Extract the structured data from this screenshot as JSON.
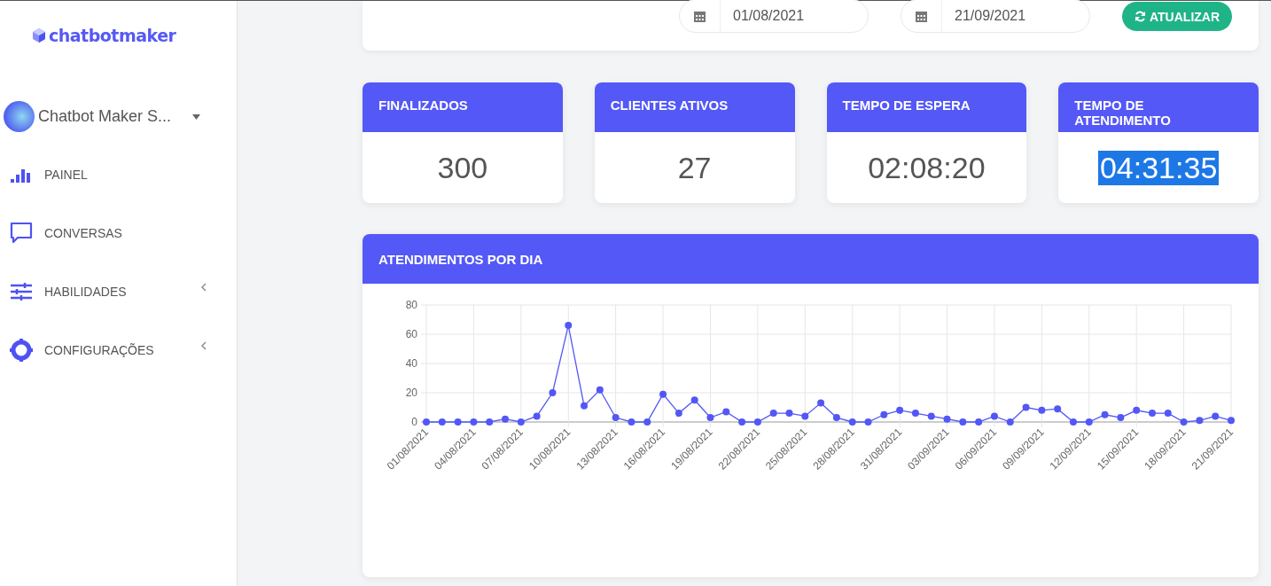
{
  "sidebar": {
    "logo": "chatbotmaker",
    "account": {
      "name": "Chatbot Maker S..."
    },
    "items": [
      {
        "label": "PAINEL",
        "kind": "bars",
        "expandable": false
      },
      {
        "label": "CONVERSAS",
        "kind": "chat",
        "expandable": false
      },
      {
        "label": "HABILIDADES",
        "kind": "sliders",
        "expandable": true
      },
      {
        "label": "CONFIGURAÇÕES",
        "kind": "gear",
        "expandable": true
      }
    ]
  },
  "filters": {
    "start_date": "01/08/2021",
    "end_date": "21/09/2021",
    "refresh_button": "ATUALIZAR"
  },
  "stats": [
    {
      "title": "FINALIZADOS",
      "value": "300",
      "highlighted": false
    },
    {
      "title": "CLIENTES ATIVOS",
      "value": "27",
      "highlighted": false
    },
    {
      "title": "TEMPO DE ESPERA",
      "value": "02:08:20",
      "highlighted": false
    },
    {
      "title": "TEMPO DE ATENDIMENTO",
      "value": "04:31:35",
      "highlighted": true
    }
  ],
  "chart_card": {
    "title": "ATENDIMENTOS POR DIA",
    "chart_data": {
      "type": "line",
      "categories": [
        "01/08/2021",
        null,
        null,
        "04/08/2021",
        null,
        null,
        "07/08/2021",
        null,
        null,
        "10/08/2021",
        null,
        null,
        "13/08/2021",
        null,
        null,
        "16/08/2021",
        null,
        null,
        "19/08/2021",
        null,
        null,
        "22/08/2021",
        null,
        null,
        "25/08/2021",
        null,
        null,
        "28/08/2021",
        null,
        null,
        "31/08/2021",
        null,
        null,
        "03/09/2021",
        null,
        null,
        "06/09/2021",
        null,
        null,
        "09/09/2021",
        null,
        null,
        "12/09/2021",
        null,
        null,
        "15/09/2021",
        null,
        null,
        "18/09/2021",
        null,
        null,
        "21/09/2021"
      ],
      "grid": true,
      "series": [
        {
          "color": "#5257f5",
          "marker": "circle",
          "values": [
            0,
            0,
            0,
            0,
            0,
            2,
            0,
            4,
            20,
            66,
            11,
            22,
            3,
            0,
            0,
            19,
            6,
            15,
            3,
            7,
            0,
            0,
            6,
            6,
            4,
            13,
            3,
            0,
            0,
            5,
            8,
            6,
            4,
            2,
            0,
            0,
            4,
            0,
            10,
            8,
            9,
            0,
            0,
            5,
            3,
            8,
            6,
            6,
            0,
            1,
            4,
            1
          ]
        }
      ],
      "ylim": [
        0,
        80
      ],
      "yticks": [
        0,
        20,
        40,
        60,
        80
      ]
    }
  }
}
